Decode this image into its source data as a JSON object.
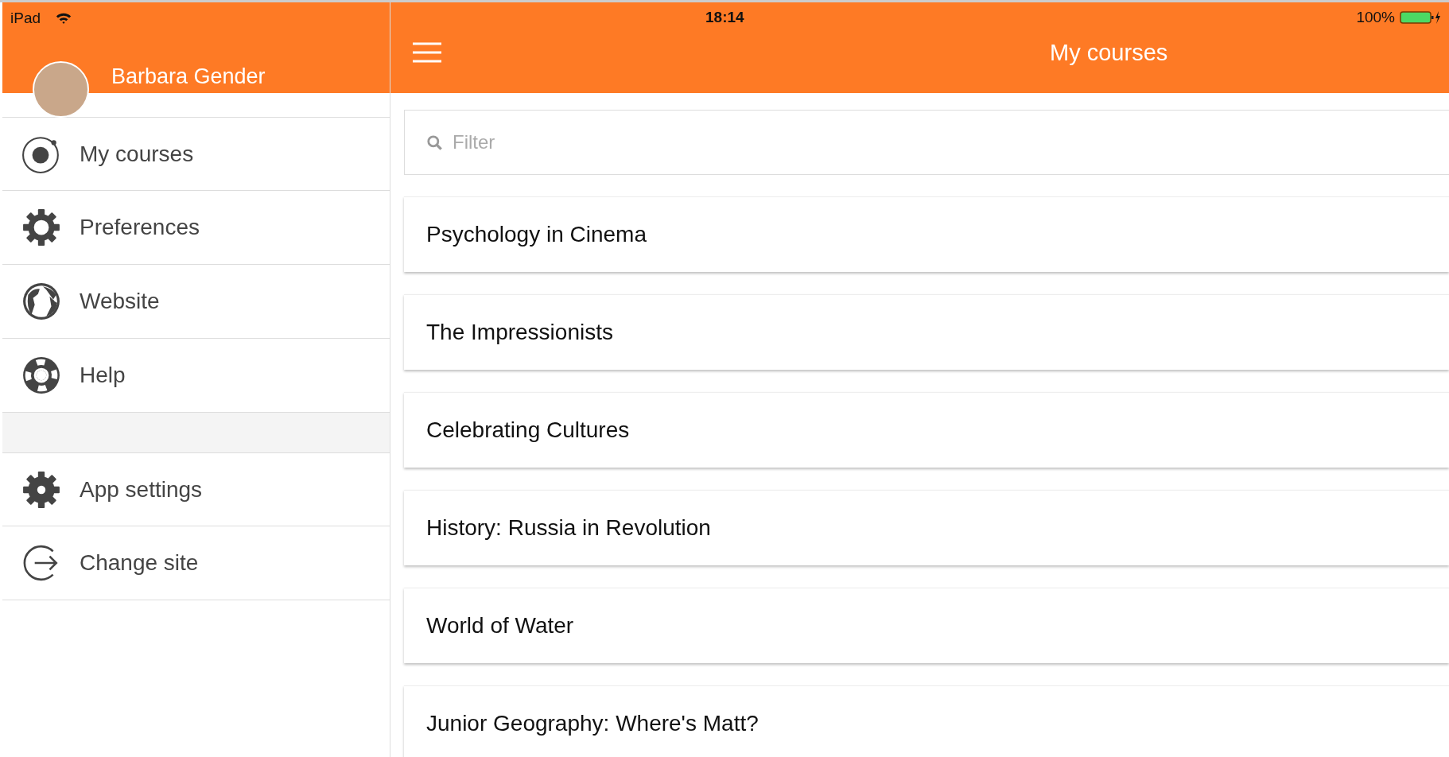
{
  "status_bar": {
    "device": "iPad",
    "time": "18:14",
    "battery": "100%"
  },
  "user": {
    "name": "Barbara Gender"
  },
  "header": {
    "title": "My courses"
  },
  "menu": [
    {
      "label": "My courses"
    },
    {
      "label": "Preferences"
    },
    {
      "label": "Website"
    },
    {
      "label": "Help"
    }
  ],
  "settings_menu": [
    {
      "label": "App settings"
    },
    {
      "label": "Change site"
    }
  ],
  "filter": {
    "placeholder": "Filter"
  },
  "courses": [
    {
      "title": "Psychology in Cinema"
    },
    {
      "title": "The Impressionists"
    },
    {
      "title": "Celebrating Cultures"
    },
    {
      "title": "History: Russia in Revolution"
    },
    {
      "title": "World of Water"
    },
    {
      "title": "Junior Geography: Where's Matt?"
    }
  ]
}
